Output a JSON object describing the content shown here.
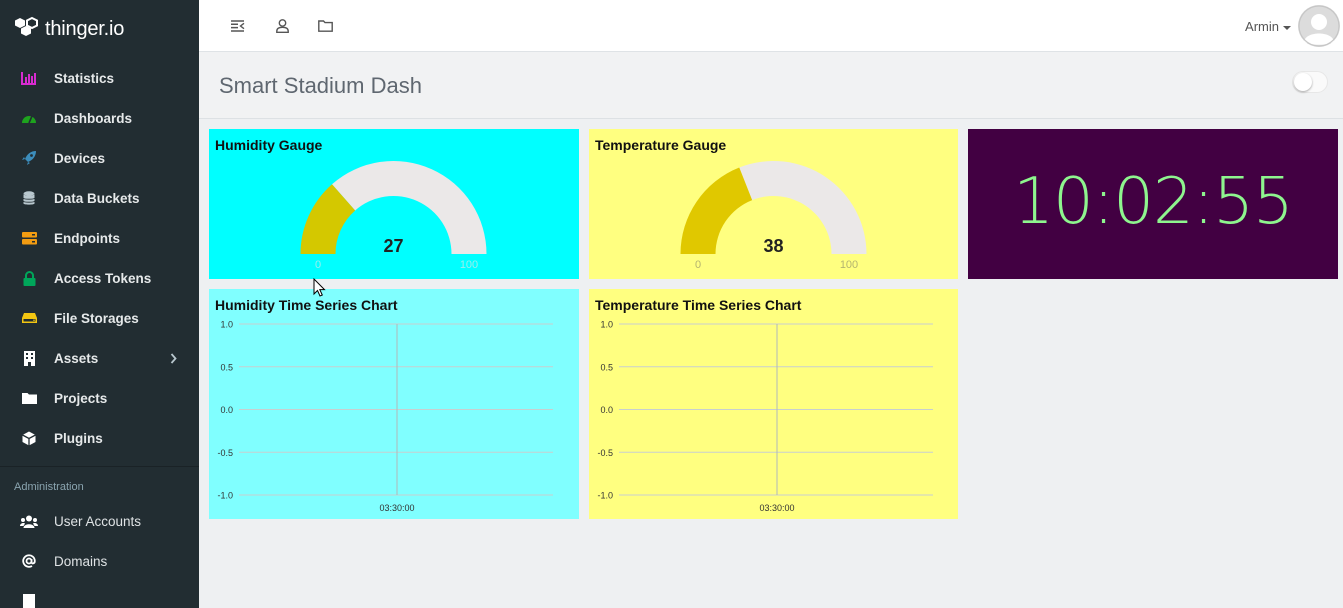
{
  "brand": {
    "name": "thinger.io"
  },
  "sidebar": {
    "items": [
      {
        "label": "Statistics",
        "icon": "bar-chart-icon",
        "color": "#d72bd0"
      },
      {
        "label": "Dashboards",
        "icon": "speedometer-icon",
        "color": "#1ea31e"
      },
      {
        "label": "Devices",
        "icon": "rocket-icon",
        "color": "#3c8dbc"
      },
      {
        "label": "Data Buckets",
        "icon": "database-icon",
        "color": "#b8c7ce"
      },
      {
        "label": "Endpoints",
        "icon": "server-icon",
        "color": "#f39c12"
      },
      {
        "label": "Access Tokens",
        "icon": "lock-icon",
        "color": "#00a65a"
      },
      {
        "label": "File Storages",
        "icon": "hdd-icon",
        "color": "#f3c612"
      },
      {
        "label": "Assets",
        "icon": "building-icon",
        "color": "#ffffff"
      },
      {
        "label": "Projects",
        "icon": "folder-icon",
        "color": "#ffffff"
      },
      {
        "label": "Plugins",
        "icon": "cube-icon",
        "color": "#ffffff"
      }
    ],
    "admin_header": "Administration",
    "admin_items": [
      {
        "label": "User Accounts",
        "icon": "users-icon"
      },
      {
        "label": "Domains",
        "icon": "at-sign-icon"
      }
    ]
  },
  "topbar": {
    "icons": [
      "menu-toggle-icon",
      "user-icon",
      "folder-icon"
    ],
    "user_name": "Armin"
  },
  "page": {
    "title": "Smart Stadium Dash"
  },
  "widgets": {
    "humidity_gauge": {
      "title": "Humidity Gauge",
      "value": "27",
      "min": "0",
      "max": "100",
      "background": "#00ffff",
      "fill": "#d4c800",
      "track": "#ebe8e8"
    },
    "temperature_gauge": {
      "title": "Temperature Gauge",
      "value": "38",
      "min": "0",
      "max": "100",
      "background": "#ffff80",
      "fill": "#e0c800",
      "track": "#ebe8e8"
    },
    "clock": {
      "time": "10:02:55",
      "background": "#420042",
      "color": "#8ef58e"
    },
    "humidity_chart": {
      "title": "Humidity Time Series Chart",
      "background": "#80ffff"
    },
    "temperature_chart": {
      "title": "Temperature Time Series Chart",
      "background": "#ffff80"
    }
  },
  "chart_data": [
    {
      "type": "line",
      "title": "Humidity Time Series Chart",
      "xlabel": "",
      "ylabel": "",
      "ylim": [
        -1.0,
        1.0
      ],
      "y_ticks": [
        "1.0",
        "0.5",
        "0.0",
        "-0.5",
        "-1.0"
      ],
      "x_ticks": [
        "03:30:00"
      ],
      "grid": true,
      "series": []
    },
    {
      "type": "line",
      "title": "Temperature Time Series Chart",
      "xlabel": "",
      "ylabel": "",
      "ylim": [
        -1.0,
        1.0
      ],
      "y_ticks": [
        "1.0",
        "0.5",
        "0.0",
        "-0.5",
        "-1.0"
      ],
      "x_ticks": [
        "03:30:00"
      ],
      "grid": true,
      "series": []
    }
  ]
}
